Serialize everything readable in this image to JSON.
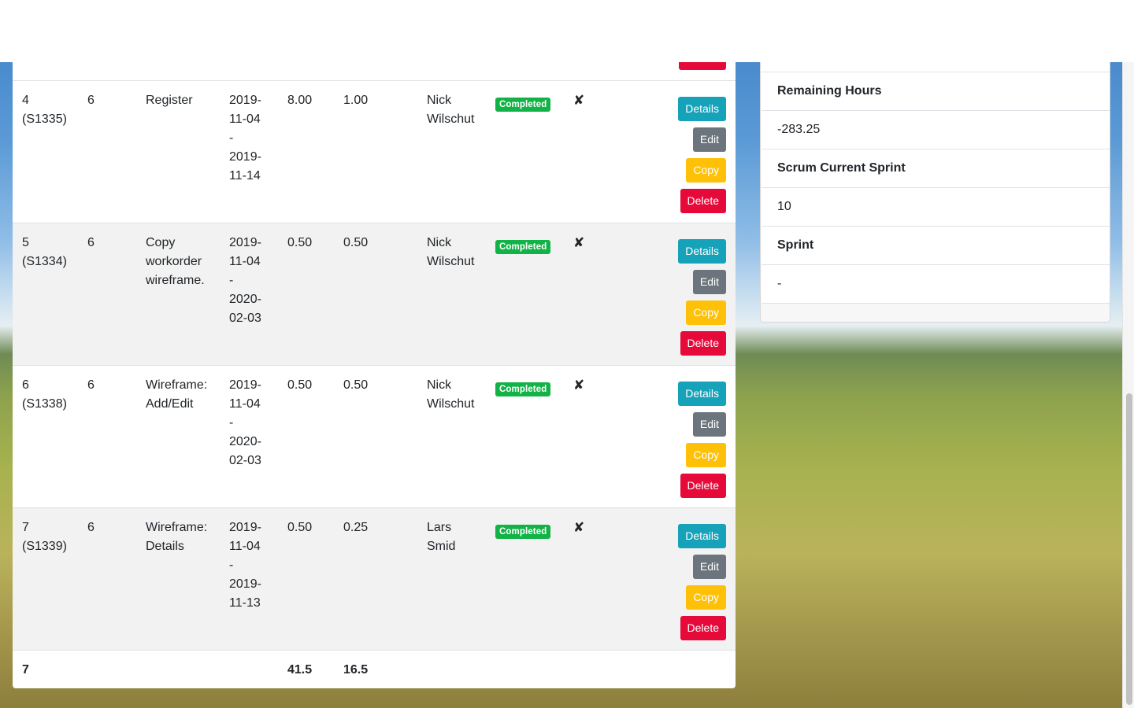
{
  "tasks": [
    {
      "id": "4",
      "code": "(S1335)",
      "level": "6",
      "name_lines": [
        "Register",
        "",
        ""
      ],
      "date_lines": [
        "2019-",
        "11-04",
        "-",
        "2019-",
        "11-14"
      ],
      "estimate": "8.00",
      "actual": "1.00",
      "user_lines": [
        "Nick",
        "Wilschut"
      ],
      "status": "Completed",
      "flag": "✘"
    },
    {
      "id": "5",
      "code": "(S1334)",
      "level": "6",
      "name_lines": [
        "Copy",
        "workorder",
        "wireframe."
      ],
      "date_lines": [
        "2019-",
        "11-04",
        "-",
        "2020-",
        "02-03"
      ],
      "estimate": "0.50",
      "actual": "0.50",
      "user_lines": [
        "Nick",
        "Wilschut"
      ],
      "status": "Completed",
      "flag": "✘"
    },
    {
      "id": "6",
      "code": "(S1338)",
      "level": "6",
      "name_lines": [
        "Wireframe:",
        "Add/Edit",
        ""
      ],
      "date_lines": [
        "2019-",
        "11-04",
        "-",
        "2020-",
        "02-03"
      ],
      "estimate": "0.50",
      "actual": "0.50",
      "user_lines": [
        "Nick",
        "Wilschut"
      ],
      "status": "Completed",
      "flag": "✘"
    },
    {
      "id": "7",
      "code": "(S1339)",
      "level": "6",
      "name_lines": [
        "Wireframe:",
        "Details",
        ""
      ],
      "date_lines": [
        "2019-",
        "11-04",
        "-",
        "2019-",
        "11-13"
      ],
      "estimate": "0.50",
      "actual": "0.25",
      "user_lines": [
        "Lars",
        "Smid"
      ],
      "status": "Completed",
      "flag": "✘"
    }
  ],
  "buttons": {
    "details": "Details",
    "edit": "Edit",
    "copy": "Copy",
    "delete": "Delete"
  },
  "totals": {
    "count": "7",
    "estimate": "41.5",
    "actual": "16.5"
  },
  "info": {
    "remaining_hours_label": "Remaining Hours",
    "remaining_hours_value": "-283.25",
    "scrum_current_sprint_label": "Scrum Current Sprint",
    "scrum_current_sprint_value": "10",
    "sprint_label": "Sprint",
    "sprint_value": "-"
  },
  "colors": {
    "details": "#16a2b8",
    "edit": "#6c757d",
    "copy": "#ffc107",
    "delete": "#e60a3a",
    "completed": "#12b346"
  }
}
